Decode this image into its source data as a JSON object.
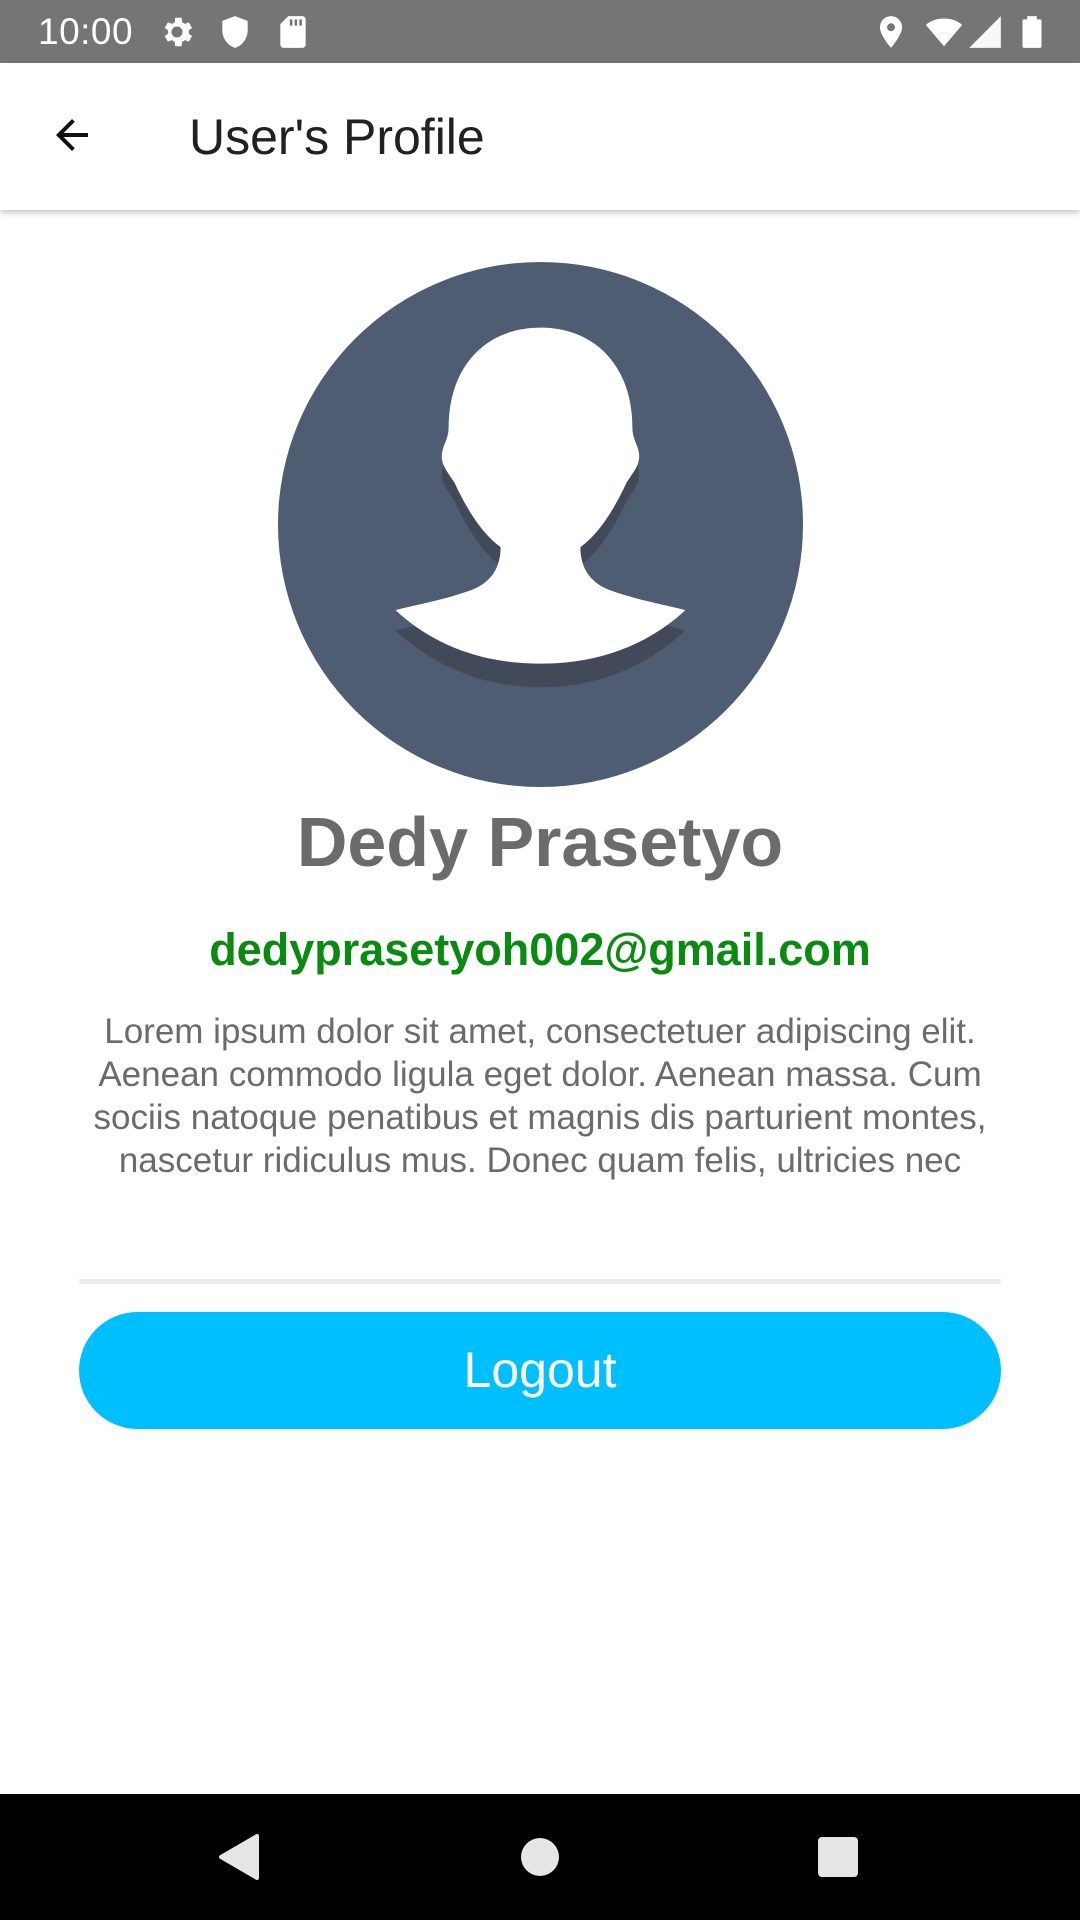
{
  "status_bar": {
    "time": "10:00",
    "icons_left": [
      "gear-icon",
      "shield-icon",
      "sd-card-icon"
    ],
    "icons_right": [
      "location-icon",
      "wifi-icon",
      "signal-icon",
      "battery-icon"
    ]
  },
  "app_bar": {
    "title": "User's Profile",
    "back_icon": "arrow-left-icon"
  },
  "profile": {
    "avatar_icon": "user-avatar-icon",
    "avatar_color": "#4f5d73",
    "name": "Dedy Prasetyo",
    "email": "dedyprasetyoh002@gmail.com",
    "email_color": "#0b8a12",
    "bio": "Lorem ipsum dolor sit amet, consectetuer adipiscing elit. Aenean commodo ligula eget dolor. Aenean massa. Cum sociis natoque penatibus et magnis dis parturient montes, nascetur ridiculus mus. Donec quam felis, ultricies nec"
  },
  "actions": {
    "logout_label": "Logout",
    "logout_color": "#00bfff"
  },
  "nav_bar": {
    "buttons": [
      "back-triangle-icon",
      "home-circle-icon",
      "recents-square-icon"
    ]
  }
}
